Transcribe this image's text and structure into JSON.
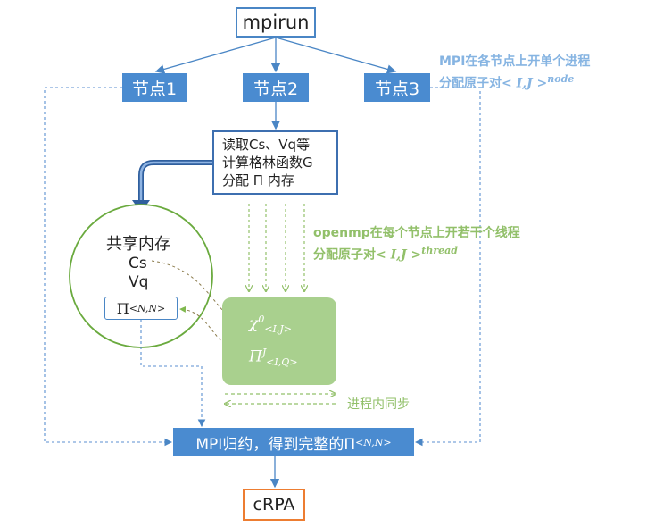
{
  "top": {
    "label": "mpirun"
  },
  "nodes": [
    {
      "label": "节点1"
    },
    {
      "label": "节点2"
    },
    {
      "label": "节点3"
    }
  ],
  "mpi_note": {
    "line1": "MPI在各节点上开单个进程",
    "line2": "分配原子对",
    "math": "< I,J >",
    "sup": "node"
  },
  "read_box": {
    "lines": [
      "读取Cs、Vq等",
      "计算格林函数G",
      "分配 Π 内存"
    ]
  },
  "shared_memory": {
    "title": "共享内存",
    "items": [
      "Cs",
      "Vq"
    ],
    "pi_symbol": "Π",
    "pi_sub": "<N,N>"
  },
  "openmp_note": {
    "line1": "openmp在每个节点上开若干个线程",
    "line2": "分配原子对",
    "math": "< I,J >",
    "sup": "thread"
  },
  "thread_box": {
    "chi": "χ",
    "chi_sup": "0",
    "chi_sub": "<I,J>",
    "pi": "Π",
    "pi_sup": "J",
    "pi_sub": "<I,Q>"
  },
  "sync_label": "进程内同步",
  "reduce": {
    "label": "MPI归约，得到完整的Π",
    "sub": "<N,N>"
  },
  "final": {
    "label": "cRPA"
  },
  "colors": {
    "blue": "#4a8bd0",
    "dashed_blue": "#5b8fd0",
    "green": "#a9d08e",
    "green_text": "#92c06a",
    "orange": "#ed7d31"
  }
}
